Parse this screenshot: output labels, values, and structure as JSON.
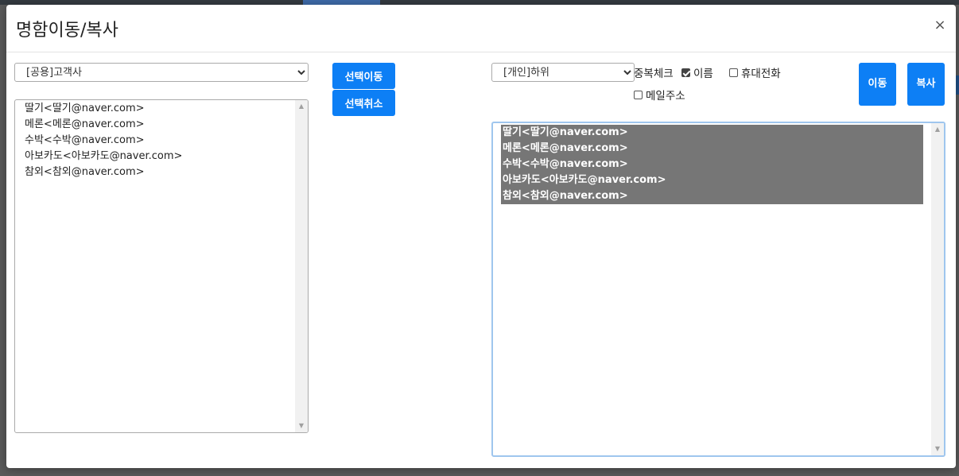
{
  "modal": {
    "title": "명함이동/복사",
    "close_label": "×"
  },
  "left": {
    "group_select": {
      "value": "[공용]고객사",
      "options": [
        "[공용]고객사"
      ]
    },
    "items": [
      "딸기<딸기@naver.com>",
      "메론<메론@naver.com>",
      "수박<수박@naver.com>",
      "아보카도<아보카도@naver.com>",
      "참외<참외@naver.com>"
    ]
  },
  "middle": {
    "move_selected_label": "선택이동",
    "cancel_selected_label": "선택취소"
  },
  "right": {
    "group_select": {
      "value": "[개인]하위",
      "options": [
        "[개인]하위"
      ]
    },
    "dup_check_label": "중복체크",
    "checks": {
      "name": {
        "label": "이름",
        "checked": true
      },
      "phone": {
        "label": "휴대전화",
        "checked": false
      },
      "email": {
        "label": "메일주소",
        "checked": false
      }
    },
    "move_button": {
      "line1": "이",
      "line2": "동"
    },
    "copy_button": {
      "line1": "복",
      "line2": "사"
    },
    "items": [
      "딸기<딸기@naver.com>",
      "메론<메론@naver.com>",
      "수박<수박@naver.com>",
      "아보카도<아보카도@naver.com>",
      "참외<참외@naver.com>"
    ]
  },
  "icons": {
    "scroll_up": "▲",
    "scroll_down": "▼"
  }
}
